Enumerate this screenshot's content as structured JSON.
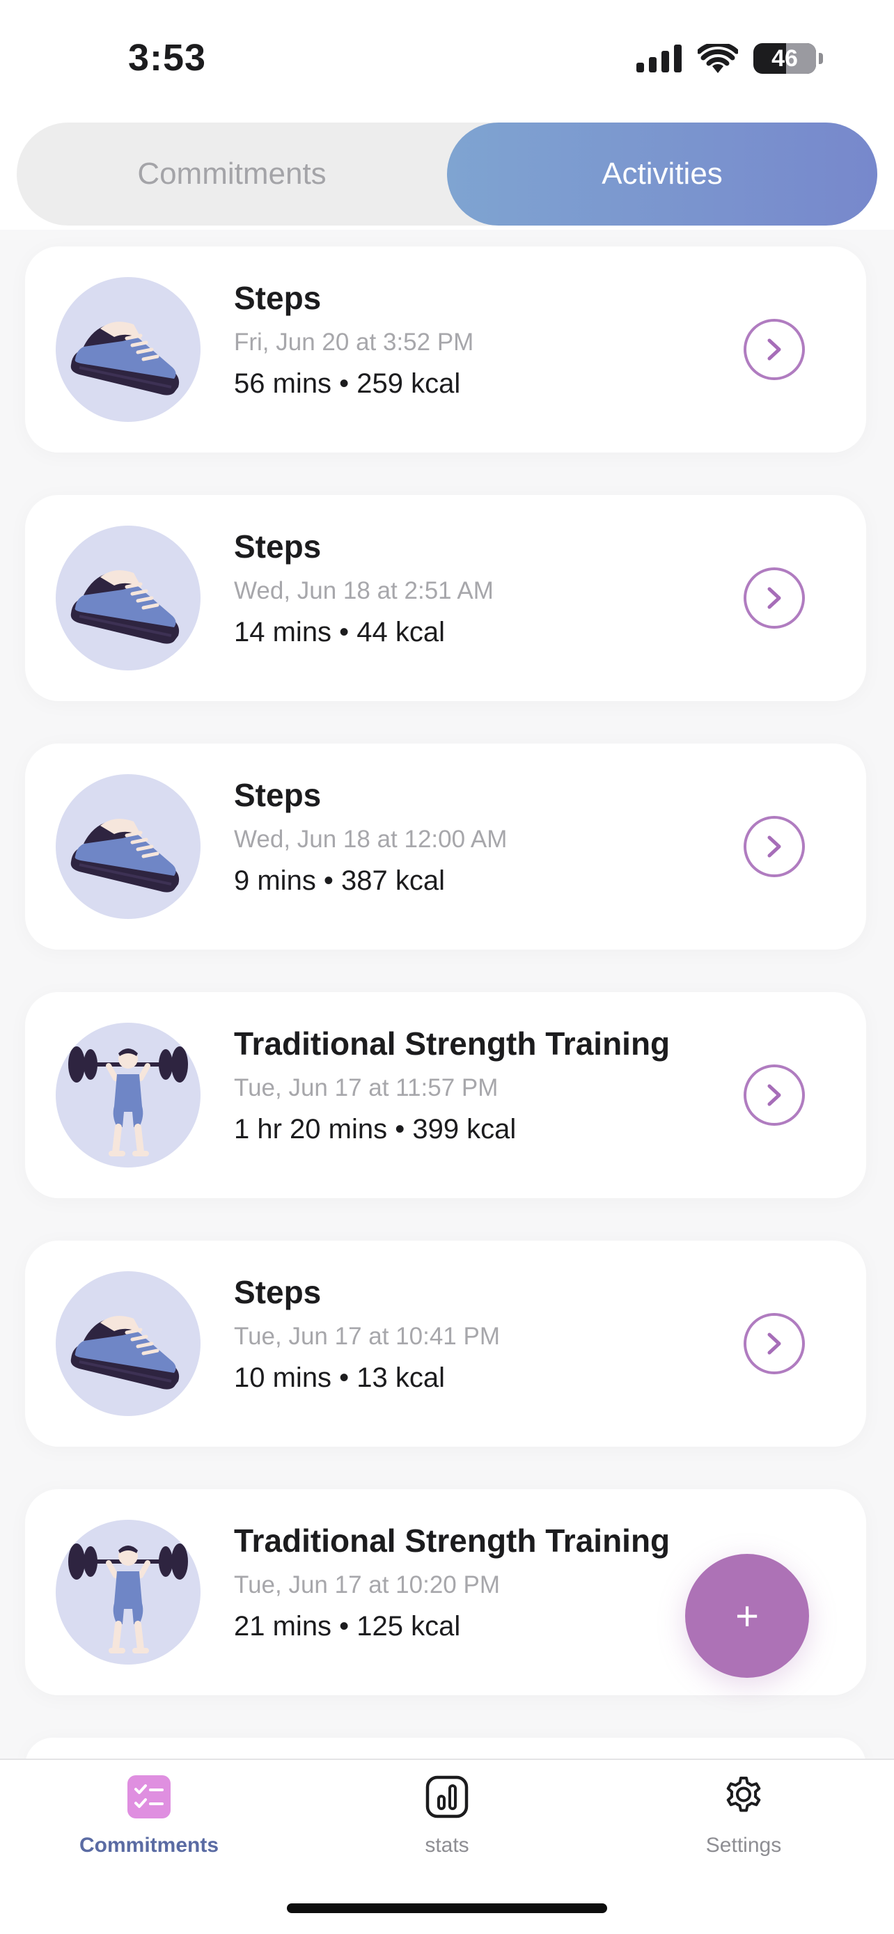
{
  "status_bar": {
    "time": "3:53",
    "battery_level": "46"
  },
  "segmented": {
    "commitments_label": "Commitments",
    "activities_label": "Activities",
    "selected": "Activities"
  },
  "colors": {
    "accent": "#ad72b6",
    "segment_active_start": "#7fa4d1",
    "segment_active_end": "#7788cc",
    "tab_active": "#5a6ba3",
    "avatar_bg": "#d9dcf1"
  },
  "activities": [
    {
      "title": "Steps",
      "date": "Fri, Jun 20 at 3:52 PM",
      "stats": "56 mins • 259 kcal",
      "icon": "sneaker-icon"
    },
    {
      "title": "Steps",
      "date": "Wed, Jun 18 at 2:51 AM",
      "stats": "14 mins • 44 kcal",
      "icon": "sneaker-icon"
    },
    {
      "title": "Steps",
      "date": "Wed, Jun 18 at 12:00 AM",
      "stats": "9 mins • 387 kcal",
      "icon": "sneaker-icon"
    },
    {
      "title": "Traditional Strength Training",
      "date": "Tue, Jun 17 at 11:57 PM",
      "stats": "1 hr 20 mins • 399 kcal",
      "icon": "weightlifter-icon"
    },
    {
      "title": "Steps",
      "date": "Tue, Jun 17 at 10:41 PM",
      "stats": "10 mins • 13 kcal",
      "icon": "sneaker-icon"
    },
    {
      "title": "Traditional Strength Training",
      "date": "Tue, Jun 17 at 10:20 PM",
      "stats": "21 mins • 125 kcal",
      "icon": "weightlifter-icon"
    }
  ],
  "fab": {
    "label": "+"
  },
  "tab_bar": {
    "items": [
      {
        "label": "Commitments",
        "icon": "checklist-icon",
        "active": true
      },
      {
        "label": "stats",
        "icon": "bar-chart-icon",
        "active": false
      },
      {
        "label": "Settings",
        "icon": "gear-icon",
        "active": false
      }
    ]
  }
}
